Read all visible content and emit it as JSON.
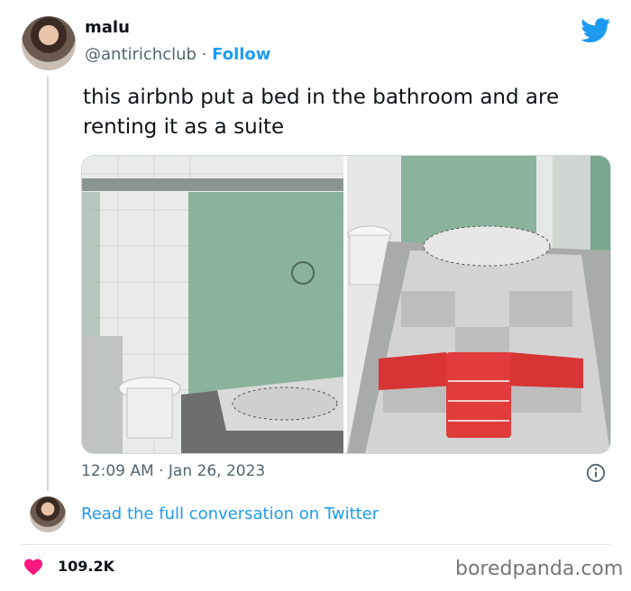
{
  "author": {
    "name": "malu",
    "handle": "@antirichclub",
    "separator": "·",
    "follow_label": "Follow"
  },
  "tweet": {
    "text": "this airbnb put a bed in the bathroom and are renting it as a suite",
    "time": "12:09 AM · Jan 26, 2023"
  },
  "link": {
    "read_label": "Read the full conversation on Twitter"
  },
  "stats": {
    "likes": "109.2K"
  },
  "watermark": "boredpanda.com",
  "icons": [
    "twitter-bird-icon",
    "info-icon",
    "heart-icon"
  ],
  "colors": {
    "accent": "#1d9bf0",
    "heart": "#f91880",
    "secondary_text": "#536471"
  }
}
